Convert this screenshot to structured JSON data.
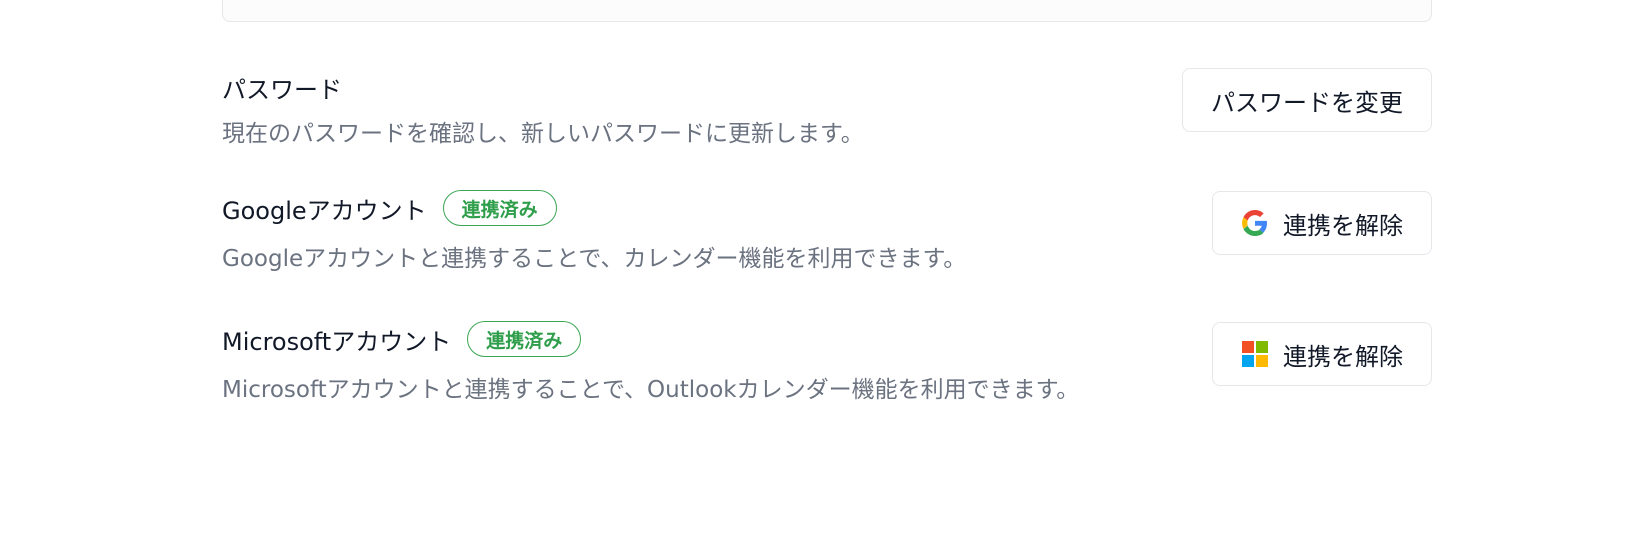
{
  "email_field": {
    "value": ""
  },
  "password": {
    "title": "パスワード",
    "description": "現在のパスワードを確認し、新しいパスワードに更新します。",
    "button_label": "パスワードを変更"
  },
  "google": {
    "title": "Googleアカウント",
    "badge": "連携済み",
    "description": "Googleアカウントと連携することで、カレンダー機能を利用できます。",
    "button_label": "連携を解除",
    "icon": "google-icon"
  },
  "microsoft": {
    "title": "Microsoftアカウント",
    "badge": "連携済み",
    "description": "Microsoftアカウントと連携することで、Outlookカレンダー機能を利用できます。",
    "button_label": "連携を解除",
    "icon": "microsoft-icon"
  },
  "colors": {
    "badge_green": "#2f9e4b",
    "muted_text": "#6b7280",
    "border": "#e5e7eb"
  }
}
